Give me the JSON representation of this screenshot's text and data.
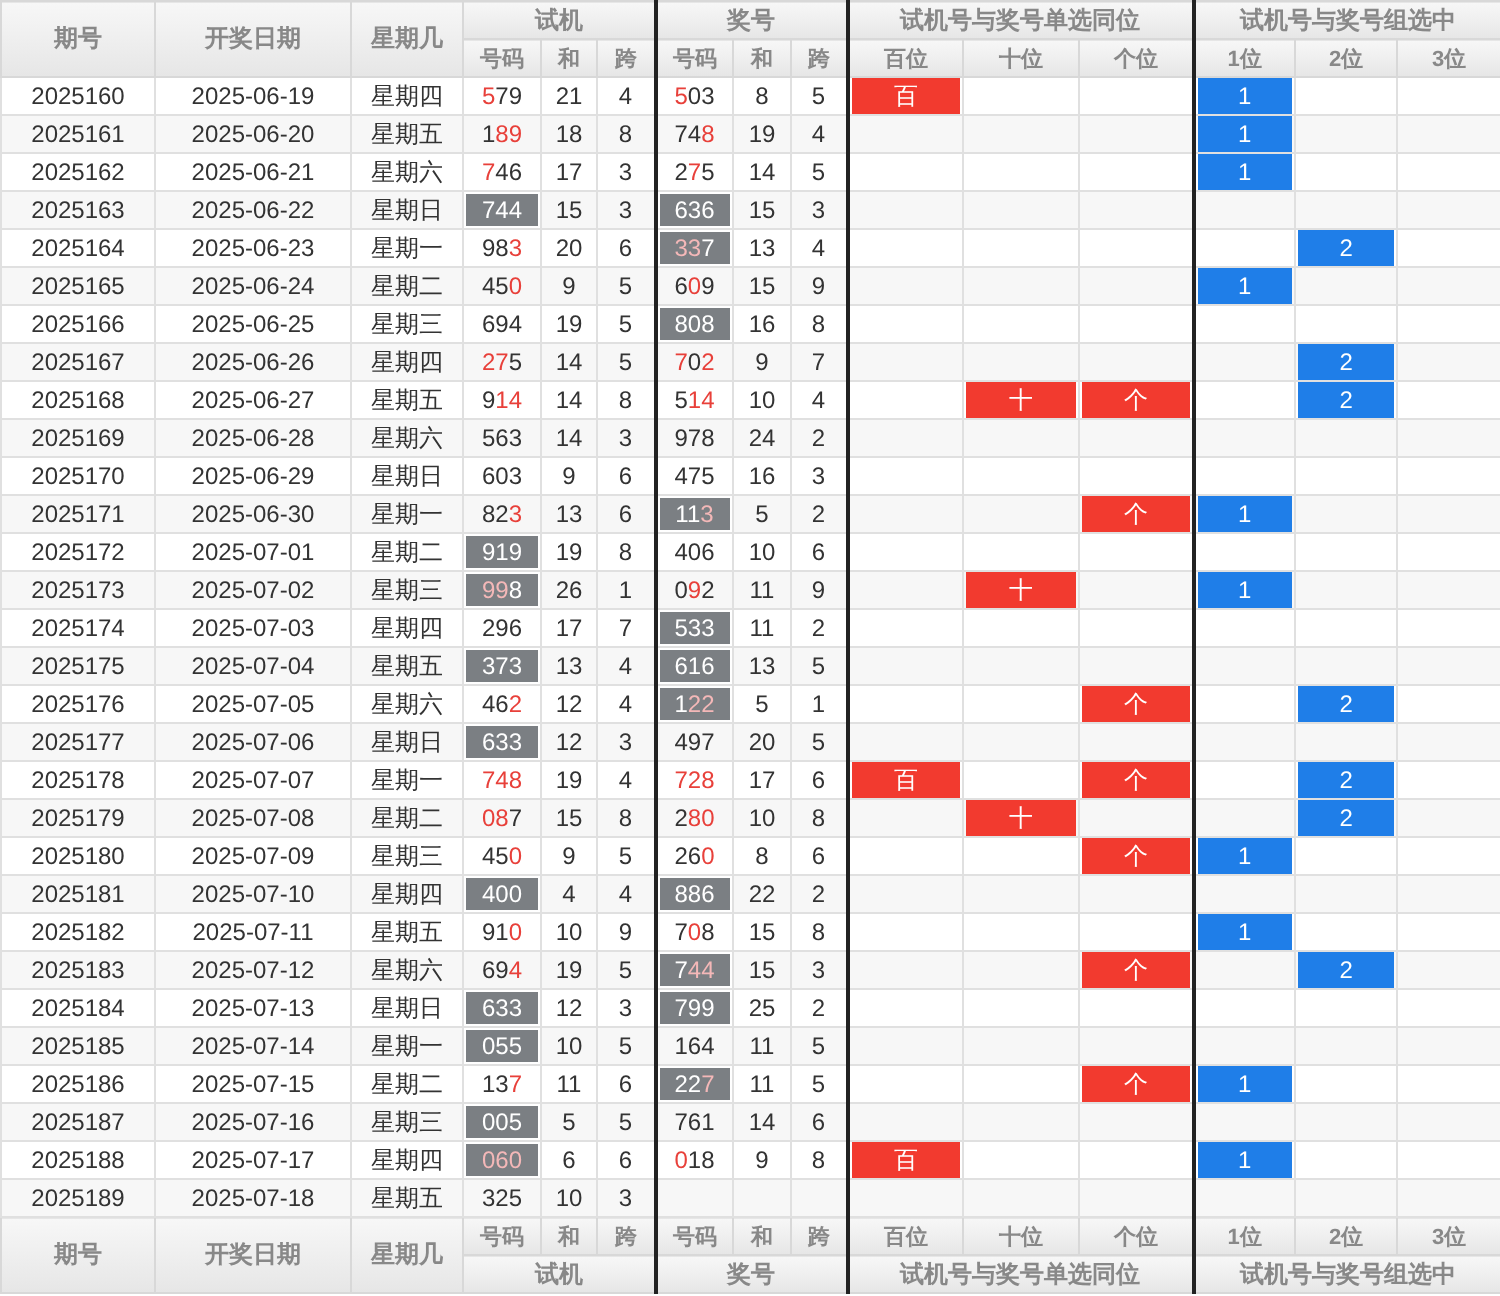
{
  "top_header": {
    "columns": [
      "期号",
      "开奖日期",
      "星期几"
    ],
    "groups": [
      {
        "title": "试机",
        "subs": [
          "号码",
          "和",
          "跨"
        ]
      },
      {
        "title": "奖号",
        "subs": [
          "号码",
          "和",
          "跨"
        ]
      },
      {
        "title": "试机号与奖号单选同位",
        "subs": [
          "百位",
          "十位",
          "个位"
        ]
      },
      {
        "title": "试机号与奖号组选中",
        "subs": [
          "1位",
          "2位",
          "3位"
        ]
      }
    ]
  },
  "rows": [
    {
      "issue": "2025160",
      "date": "2025-06-19",
      "weekday": "星期四",
      "trial": {
        "number": "579",
        "hits": [
          true,
          false,
          false
        ],
        "pair": false,
        "sum": "21",
        "span": "4"
      },
      "prize": {
        "number": "503",
        "hits": [
          true,
          false,
          false
        ],
        "pair": false,
        "sum": "8",
        "span": "5"
      },
      "same_position": {
        "hundreds": "百"
      },
      "group_hits": {
        "first": "1"
      }
    },
    {
      "issue": "2025161",
      "date": "2025-06-20",
      "weekday": "星期五",
      "trial": {
        "number": "189",
        "hits": [
          false,
          true,
          true
        ],
        "pair": false,
        "sum": "18",
        "span": "8"
      },
      "prize": {
        "number": "748",
        "hits": [
          false,
          false,
          true
        ],
        "pair": false,
        "sum": "19",
        "span": "4"
      },
      "group_hits": {
        "first": "1"
      }
    },
    {
      "issue": "2025162",
      "date": "2025-06-21",
      "weekday": "星期六",
      "trial": {
        "number": "746",
        "hits": [
          true,
          false,
          false
        ],
        "pair": false,
        "sum": "17",
        "span": "3"
      },
      "prize": {
        "number": "275",
        "hits": [
          false,
          true,
          false
        ],
        "pair": false,
        "sum": "14",
        "span": "5"
      },
      "group_hits": {
        "first": "1"
      }
    },
    {
      "issue": "2025163",
      "date": "2025-06-22",
      "weekday": "星期日",
      "trial": {
        "number": "744",
        "hits": [
          false,
          false,
          false
        ],
        "pair": true,
        "sum": "15",
        "span": "3"
      },
      "prize": {
        "number": "636",
        "hits": [
          false,
          false,
          false
        ],
        "pair": true,
        "sum": "15",
        "span": "3"
      }
    },
    {
      "issue": "2025164",
      "date": "2025-06-23",
      "weekday": "星期一",
      "trial": {
        "number": "983",
        "hits": [
          false,
          false,
          true
        ],
        "pair": false,
        "sum": "20",
        "span": "6"
      },
      "prize": {
        "number": "337",
        "hits": [
          true,
          true,
          false
        ],
        "pair": true,
        "sum": "13",
        "span": "4"
      },
      "group_hits": {
        "second": "2"
      }
    },
    {
      "issue": "2025165",
      "date": "2025-06-24",
      "weekday": "星期二",
      "trial": {
        "number": "450",
        "hits": [
          false,
          false,
          true
        ],
        "pair": false,
        "sum": "9",
        "span": "5"
      },
      "prize": {
        "number": "609",
        "hits": [
          false,
          true,
          false
        ],
        "pair": false,
        "sum": "15",
        "span": "9"
      },
      "group_hits": {
        "first": "1"
      }
    },
    {
      "issue": "2025166",
      "date": "2025-06-25",
      "weekday": "星期三",
      "trial": {
        "number": "694",
        "hits": [
          false,
          false,
          false
        ],
        "pair": false,
        "sum": "19",
        "span": "5"
      },
      "prize": {
        "number": "808",
        "hits": [
          false,
          false,
          false
        ],
        "pair": true,
        "sum": "16",
        "span": "8"
      }
    },
    {
      "issue": "2025167",
      "date": "2025-06-26",
      "weekday": "星期四",
      "trial": {
        "number": "275",
        "hits": [
          true,
          true,
          false
        ],
        "pair": false,
        "sum": "14",
        "span": "5"
      },
      "prize": {
        "number": "702",
        "hits": [
          true,
          false,
          true
        ],
        "pair": false,
        "sum": "9",
        "span": "7"
      },
      "group_hits": {
        "second": "2"
      }
    },
    {
      "issue": "2025168",
      "date": "2025-06-27",
      "weekday": "星期五",
      "trial": {
        "number": "914",
        "hits": [
          false,
          true,
          true
        ],
        "pair": false,
        "sum": "14",
        "span": "8"
      },
      "prize": {
        "number": "514",
        "hits": [
          false,
          true,
          true
        ],
        "pair": false,
        "sum": "10",
        "span": "4"
      },
      "same_position": {
        "tens": "十",
        "ones": "个"
      },
      "group_hits": {
        "second": "2"
      }
    },
    {
      "issue": "2025169",
      "date": "2025-06-28",
      "weekday": "星期六",
      "trial": {
        "number": "563",
        "hits": [
          false,
          false,
          false
        ],
        "pair": false,
        "sum": "14",
        "span": "3"
      },
      "prize": {
        "number": "978",
        "hits": [
          false,
          false,
          false
        ],
        "pair": false,
        "sum": "24",
        "span": "2"
      }
    },
    {
      "issue": "2025170",
      "date": "2025-06-29",
      "weekday": "星期日",
      "trial": {
        "number": "603",
        "hits": [
          false,
          false,
          false
        ],
        "pair": false,
        "sum": "9",
        "span": "6"
      },
      "prize": {
        "number": "475",
        "hits": [
          false,
          false,
          false
        ],
        "pair": false,
        "sum": "16",
        "span": "3"
      }
    },
    {
      "issue": "2025171",
      "date": "2025-06-30",
      "weekday": "星期一",
      "trial": {
        "number": "823",
        "hits": [
          false,
          false,
          true
        ],
        "pair": false,
        "sum": "13",
        "span": "6"
      },
      "prize": {
        "number": "113",
        "hits": [
          false,
          false,
          true
        ],
        "pair": true,
        "sum": "5",
        "span": "2"
      },
      "same_position": {
        "ones": "个"
      },
      "group_hits": {
        "first": "1"
      }
    },
    {
      "issue": "2025172",
      "date": "2025-07-01",
      "weekday": "星期二",
      "trial": {
        "number": "919",
        "hits": [
          false,
          false,
          false
        ],
        "pair": true,
        "sum": "19",
        "span": "8"
      },
      "prize": {
        "number": "406",
        "hits": [
          false,
          false,
          false
        ],
        "pair": false,
        "sum": "10",
        "span": "6"
      }
    },
    {
      "issue": "2025173",
      "date": "2025-07-02",
      "weekday": "星期三",
      "trial": {
        "number": "998",
        "hits": [
          true,
          true,
          false
        ],
        "pair": true,
        "sum": "26",
        "span": "1"
      },
      "prize": {
        "number": "092",
        "hits": [
          false,
          true,
          false
        ],
        "pair": false,
        "sum": "11",
        "span": "9"
      },
      "same_position": {
        "tens": "十"
      },
      "group_hits": {
        "first": "1"
      }
    },
    {
      "issue": "2025174",
      "date": "2025-07-03",
      "weekday": "星期四",
      "trial": {
        "number": "296",
        "hits": [
          false,
          false,
          false
        ],
        "pair": false,
        "sum": "17",
        "span": "7"
      },
      "prize": {
        "number": "533",
        "hits": [
          false,
          false,
          false
        ],
        "pair": true,
        "sum": "11",
        "span": "2"
      }
    },
    {
      "issue": "2025175",
      "date": "2025-07-04",
      "weekday": "星期五",
      "trial": {
        "number": "373",
        "hits": [
          false,
          false,
          false
        ],
        "pair": true,
        "sum": "13",
        "span": "4"
      },
      "prize": {
        "number": "616",
        "hits": [
          false,
          false,
          false
        ],
        "pair": true,
        "sum": "13",
        "span": "5"
      }
    },
    {
      "issue": "2025176",
      "date": "2025-07-05",
      "weekday": "星期六",
      "trial": {
        "number": "462",
        "hits": [
          false,
          false,
          true
        ],
        "pair": false,
        "sum": "12",
        "span": "4"
      },
      "prize": {
        "number": "122",
        "hits": [
          false,
          true,
          true
        ],
        "pair": true,
        "sum": "5",
        "span": "1"
      },
      "same_position": {
        "ones": "个"
      },
      "group_hits": {
        "second": "2"
      }
    },
    {
      "issue": "2025177",
      "date": "2025-07-06",
      "weekday": "星期日",
      "trial": {
        "number": "633",
        "hits": [
          false,
          false,
          false
        ],
        "pair": true,
        "sum": "12",
        "span": "3"
      },
      "prize": {
        "number": "497",
        "hits": [
          false,
          false,
          false
        ],
        "pair": false,
        "sum": "20",
        "span": "5"
      }
    },
    {
      "issue": "2025178",
      "date": "2025-07-07",
      "weekday": "星期一",
      "trial": {
        "number": "748",
        "hits": [
          true,
          true,
          true
        ],
        "pair": false,
        "sum": "19",
        "span": "4"
      },
      "prize": {
        "number": "728",
        "hits": [
          true,
          true,
          true
        ],
        "pair": false,
        "sum": "17",
        "span": "6"
      },
      "same_position": {
        "hundreds": "百",
        "ones": "个"
      },
      "group_hits": {
        "second": "2"
      }
    },
    {
      "issue": "2025179",
      "date": "2025-07-08",
      "weekday": "星期二",
      "trial": {
        "number": "087",
        "hits": [
          true,
          true,
          false
        ],
        "pair": false,
        "sum": "15",
        "span": "8"
      },
      "prize": {
        "number": "280",
        "hits": [
          false,
          true,
          true
        ],
        "pair": false,
        "sum": "10",
        "span": "8"
      },
      "same_position": {
        "tens": "十"
      },
      "group_hits": {
        "second": "2"
      }
    },
    {
      "issue": "2025180",
      "date": "2025-07-09",
      "weekday": "星期三",
      "trial": {
        "number": "450",
        "hits": [
          false,
          false,
          true
        ],
        "pair": false,
        "sum": "9",
        "span": "5"
      },
      "prize": {
        "number": "260",
        "hits": [
          false,
          false,
          true
        ],
        "pair": false,
        "sum": "8",
        "span": "6"
      },
      "same_position": {
        "ones": "个"
      },
      "group_hits": {
        "first": "1"
      }
    },
    {
      "issue": "2025181",
      "date": "2025-07-10",
      "weekday": "星期四",
      "trial": {
        "number": "400",
        "hits": [
          false,
          false,
          false
        ],
        "pair": true,
        "sum": "4",
        "span": "4"
      },
      "prize": {
        "number": "886",
        "hits": [
          false,
          false,
          false
        ],
        "pair": true,
        "sum": "22",
        "span": "2"
      }
    },
    {
      "issue": "2025182",
      "date": "2025-07-11",
      "weekday": "星期五",
      "trial": {
        "number": "910",
        "hits": [
          false,
          false,
          true
        ],
        "pair": false,
        "sum": "10",
        "span": "9"
      },
      "prize": {
        "number": "708",
        "hits": [
          false,
          true,
          false
        ],
        "pair": false,
        "sum": "15",
        "span": "8"
      },
      "group_hits": {
        "first": "1"
      }
    },
    {
      "issue": "2025183",
      "date": "2025-07-12",
      "weekday": "星期六",
      "trial": {
        "number": "694",
        "hits": [
          false,
          false,
          true
        ],
        "pair": false,
        "sum": "19",
        "span": "5"
      },
      "prize": {
        "number": "744",
        "hits": [
          false,
          true,
          true
        ],
        "pair": true,
        "sum": "15",
        "span": "3"
      },
      "same_position": {
        "ones": "个"
      },
      "group_hits": {
        "second": "2"
      }
    },
    {
      "issue": "2025184",
      "date": "2025-07-13",
      "weekday": "星期日",
      "trial": {
        "number": "633",
        "hits": [
          false,
          false,
          false
        ],
        "pair": true,
        "sum": "12",
        "span": "3"
      },
      "prize": {
        "number": "799",
        "hits": [
          false,
          false,
          false
        ],
        "pair": true,
        "sum": "25",
        "span": "2"
      }
    },
    {
      "issue": "2025185",
      "date": "2025-07-14",
      "weekday": "星期一",
      "trial": {
        "number": "055",
        "hits": [
          false,
          false,
          false
        ],
        "pair": true,
        "sum": "10",
        "span": "5"
      },
      "prize": {
        "number": "164",
        "hits": [
          false,
          false,
          false
        ],
        "pair": false,
        "sum": "11",
        "span": "5"
      }
    },
    {
      "issue": "2025186",
      "date": "2025-07-15",
      "weekday": "星期二",
      "trial": {
        "number": "137",
        "hits": [
          false,
          false,
          true
        ],
        "pair": false,
        "sum": "11",
        "span": "6"
      },
      "prize": {
        "number": "227",
        "hits": [
          false,
          false,
          true
        ],
        "pair": true,
        "sum": "11",
        "span": "5"
      },
      "same_position": {
        "ones": "个"
      },
      "group_hits": {
        "first": "1"
      }
    },
    {
      "issue": "2025187",
      "date": "2025-07-16",
      "weekday": "星期三",
      "trial": {
        "number": "005",
        "hits": [
          false,
          false,
          false
        ],
        "pair": true,
        "sum": "5",
        "span": "5"
      },
      "prize": {
        "number": "761",
        "hits": [
          false,
          false,
          false
        ],
        "pair": false,
        "sum": "14",
        "span": "6"
      }
    },
    {
      "issue": "2025188",
      "date": "2025-07-17",
      "weekday": "星期四",
      "trial": {
        "number": "060",
        "hits": [
          true,
          true,
          true
        ],
        "pair": true,
        "sum": "6",
        "span": "6"
      },
      "prize": {
        "number": "018",
        "hits": [
          true,
          false,
          false
        ],
        "pair": false,
        "sum": "9",
        "span": "8"
      },
      "same_position": {
        "hundreds": "百"
      },
      "group_hits": {
        "first": "1"
      }
    },
    {
      "issue": "2025189",
      "date": "2025-07-18",
      "weekday": "星期五",
      "trial": {
        "number": "325",
        "hits": [
          false,
          false,
          false
        ],
        "pair": false,
        "sum": "10",
        "span": "3"
      }
    }
  ],
  "bottom_header": {
    "columns": [
      "期号",
      "开奖日期",
      "星期几"
    ],
    "groups": [
      {
        "title": "试机",
        "subs": [
          "号码",
          "和",
          "跨"
        ]
      },
      {
        "title": "奖号",
        "subs": [
          "号码",
          "和",
          "跨"
        ]
      },
      {
        "title": "试机号与奖号单选同位",
        "subs": [
          "百位",
          "十位",
          "个位"
        ]
      },
      {
        "title": "试机号与奖号组选中",
        "subs": [
          "1位",
          "2位",
          "3位"
        ]
      }
    ]
  }
}
